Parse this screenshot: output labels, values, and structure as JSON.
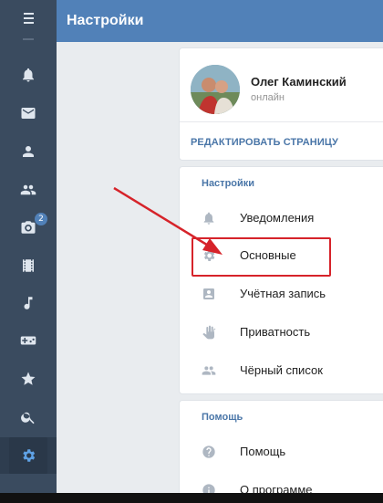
{
  "app": {
    "title": "Настройки"
  },
  "sidebar": {
    "items": [
      {
        "icon": "menu-icon"
      },
      {
        "icon": "bell-icon"
      },
      {
        "icon": "mail-icon"
      },
      {
        "icon": "person-icon"
      },
      {
        "icon": "group-icon"
      },
      {
        "icon": "camera-icon",
        "badge": "2"
      },
      {
        "icon": "film-icon"
      },
      {
        "icon": "music-icon"
      },
      {
        "icon": "gamepad-icon"
      },
      {
        "icon": "star-icon"
      },
      {
        "icon": "search-icon"
      },
      {
        "icon": "gear-icon",
        "active": true
      }
    ]
  },
  "profile": {
    "name": "Олег Каминский",
    "status": "онлайн",
    "edit_label": "РЕДАКТИРОВАТЬ СТРАНИЦУ"
  },
  "settings_section": {
    "title": "Настройки",
    "items": [
      {
        "label": "Уведомления",
        "icon": "bell-icon"
      },
      {
        "label": "Основные",
        "icon": "gear-icon",
        "highlighted": true
      },
      {
        "label": "Учётная запись",
        "icon": "account-card-icon"
      },
      {
        "label": "Приватность",
        "icon": "hand-icon"
      },
      {
        "label": "Чёрный список",
        "icon": "group-icon"
      }
    ]
  },
  "help_section": {
    "title": "Помощь",
    "items": [
      {
        "label": "Помощь",
        "icon": "question-icon"
      },
      {
        "label": "О программе",
        "icon": "info-icon"
      }
    ]
  },
  "colors": {
    "sidebar": "#3a4b5f",
    "header": "#5181b8",
    "link": "#4a76a8",
    "annotation": "#d6232a"
  }
}
